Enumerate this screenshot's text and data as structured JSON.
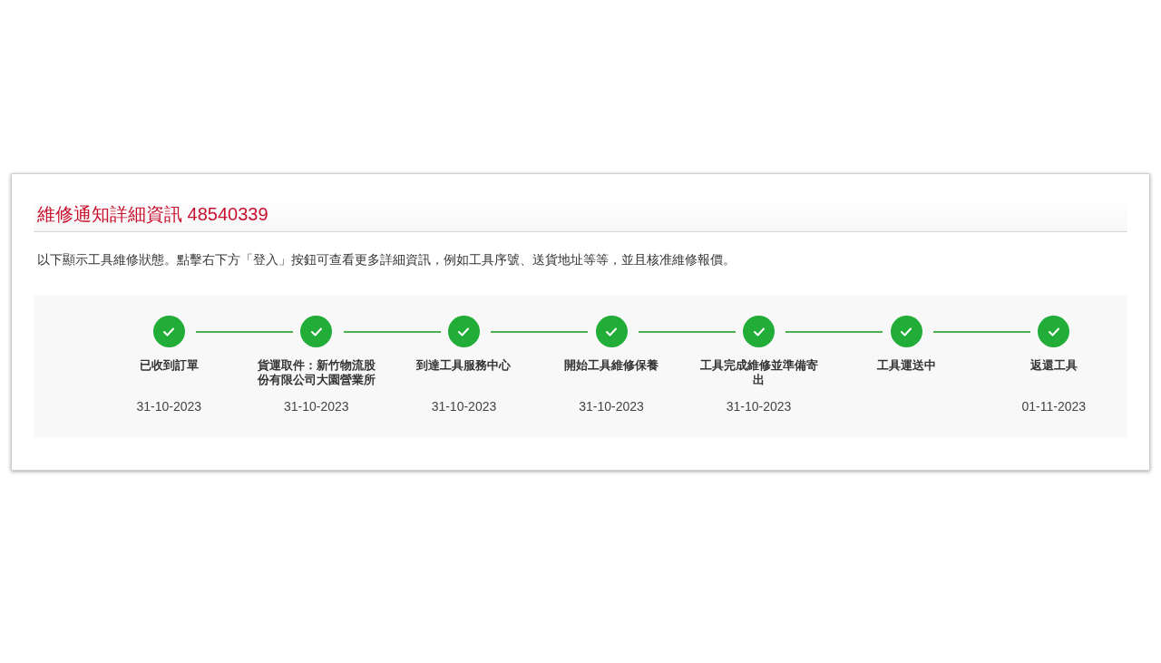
{
  "title": "維修通知詳細資訊 48540339",
  "description": "以下顯示工具維修狀態。點擊右下方「登入」按鈕可查看更多詳細資訊，例如工具序號、送貨地址等等，並且核准維修報價。",
  "steps": [
    {
      "label": "已收到訂單",
      "date": "31-10-2023",
      "done": true
    },
    {
      "label": "貨運取件：新竹物流股份有限公司大園營業所",
      "date": "31-10-2023",
      "done": true
    },
    {
      "label": "到達工具服務中心",
      "date": "31-10-2023",
      "done": true
    },
    {
      "label": "開始工具維修保養",
      "date": "31-10-2023",
      "done": true
    },
    {
      "label": "工具完成維修並準備寄出",
      "date": "31-10-2023",
      "done": true
    },
    {
      "label": "工具運送中",
      "done": true
    },
    {
      "label": "返還工具",
      "date": "01-11-2023",
      "done": true
    }
  ]
}
